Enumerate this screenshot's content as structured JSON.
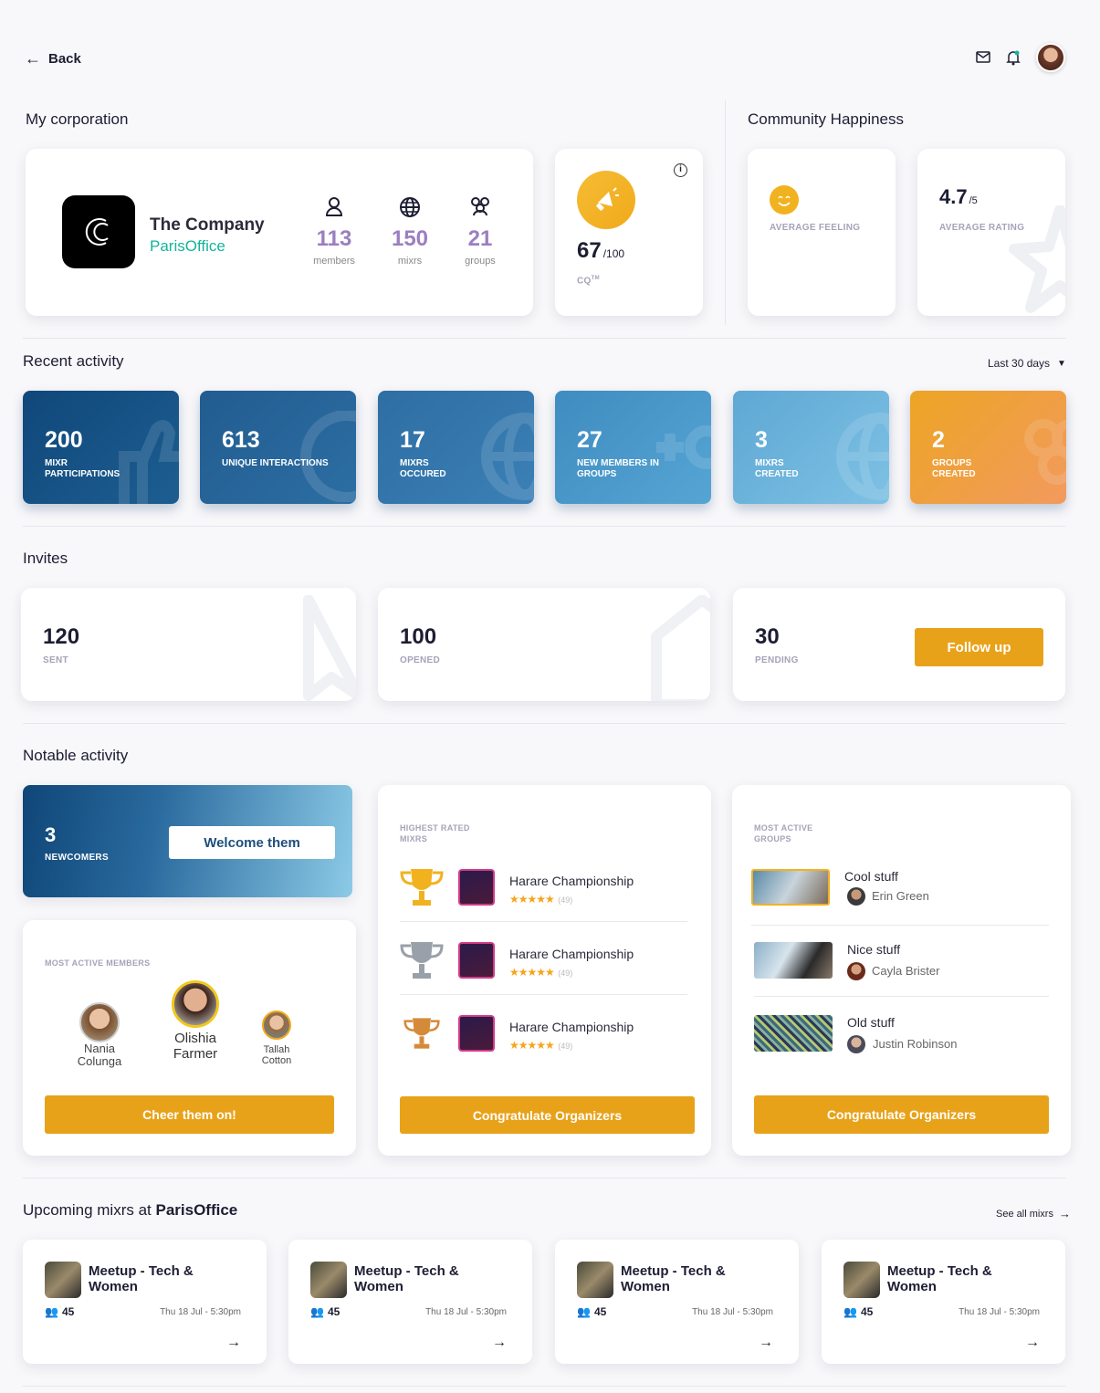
{
  "header": {
    "back_label": "Back"
  },
  "corporation": {
    "section_title": "My corporation",
    "company_name": "The Company",
    "office_name": "ParisOffice",
    "stats": [
      {
        "value": "113",
        "label": "members",
        "icon": "person-icon"
      },
      {
        "value": "150",
        "label": "mixrs",
        "icon": "globe-icon"
      },
      {
        "value": "21",
        "label": "groups",
        "icon": "group-icon"
      }
    ],
    "cq_value": "67",
    "cq_max": "/100",
    "cq_label": "CQ",
    "cq_tm": "TM"
  },
  "happiness": {
    "section_title": "Community Happiness",
    "feeling_label": "AVERAGE FEELING",
    "rating_value": "4.7",
    "rating_max": "/5",
    "rating_label": "AVERAGE RATING"
  },
  "recent": {
    "section_title": "Recent activity",
    "range": "Last 30 days",
    "tiles": [
      {
        "value": "200",
        "label": "MIXR PARTICIPATIONS"
      },
      {
        "value": "613",
        "label": "UNIQUE INTERACTIONS"
      },
      {
        "value": "17",
        "label": "MIXRS OCCURED"
      },
      {
        "value": "27",
        "label": "NEW MEMBERS IN GROUPS"
      },
      {
        "value": "3",
        "label": "MIXRS CREATED"
      },
      {
        "value": "2",
        "label": "GROUPS CREATED"
      }
    ]
  },
  "invites": {
    "section_title": "Invites",
    "sent_value": "120",
    "sent_label": "SENT",
    "opened_value": "100",
    "opened_label": "OPENED",
    "pending_value": "30",
    "pending_label": "PENDING",
    "follow_up": "Follow up"
  },
  "notable": {
    "section_title": "Notable activity",
    "newcomers_value": "3",
    "newcomers_label": "NEWCOMERS",
    "welcome_button": "Welcome them",
    "members_label": "MOST ACTIVE MEMBERS",
    "members": [
      {
        "first": "Nania",
        "last": "Colunga"
      },
      {
        "first": "Olishia",
        "last": "Farmer"
      },
      {
        "first": "Tallah",
        "last": "Cotton"
      }
    ],
    "cheer_button": "Cheer them on!",
    "rated_label_1": "HIGHEST RATED",
    "rated_label_2": "MIXRS",
    "rated": [
      {
        "name": "Harare Championship",
        "stars": "★★★★★",
        "count": "(49)"
      },
      {
        "name": "Harare Championship",
        "stars": "★★★★★",
        "count": "(49)"
      },
      {
        "name": "Harare Championship",
        "stars": "★★★★★",
        "count": "(49)"
      }
    ],
    "congrats_button": "Congratulate Organizers",
    "groups_label_1": "MOST ACTIVE",
    "groups_label_2": "GROUPS",
    "groups": [
      {
        "name": "Cool stuff",
        "owner": "Erin Green"
      },
      {
        "name": "Nice stuff",
        "owner": "Cayla Brister"
      },
      {
        "name": "Old stuff",
        "owner": "Justin Robinson"
      }
    ],
    "congrats_button_2": "Congratulate Organizers"
  },
  "upcoming": {
    "title_prefix": "Upcoming mixrs at ",
    "title_office": "ParisOffice",
    "see_all": "See all mixrs",
    "mixrs": [
      {
        "title": "Meetup - Tech & Women",
        "people": "45",
        "date": "Thu 18 Jul - 5:30pm"
      },
      {
        "title": "Meetup - Tech & Women",
        "people": "45",
        "date": "Thu 18 Jul - 5:30pm"
      },
      {
        "title": "Meetup - Tech & Women",
        "people": "45",
        "date": "Thu 18 Jul - 5:30pm"
      },
      {
        "title": "Meetup - Tech & Women",
        "people": "45",
        "date": "Thu 18 Jul - 5:30pm"
      }
    ]
  },
  "colors": {
    "accent": "#e8a21a",
    "brand_green": "#14b39a",
    "stat_purple": "#9b7fc0",
    "navy": "#1d1d33"
  }
}
